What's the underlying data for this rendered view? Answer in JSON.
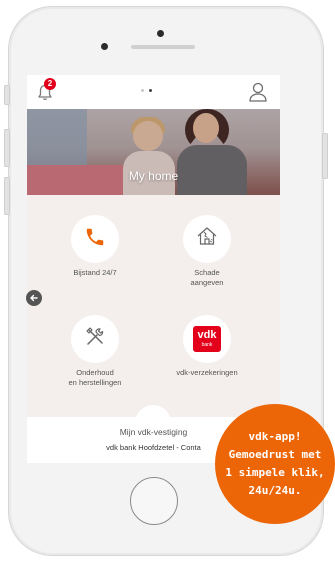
{
  "notifications": {
    "badge_count": "2",
    "icon": "bell-icon"
  },
  "pager": {
    "total": 2,
    "active_index": 1
  },
  "profile": {
    "icon": "user-icon"
  },
  "hero": {
    "title": "My home"
  },
  "actions": [
    {
      "label": "Bijstand 24/7",
      "icon": "phone-icon"
    },
    {
      "label": "Schade\naangeven",
      "icon": "house-damage-icon"
    },
    {
      "label": "Onderhoud\nen herstellingen",
      "icon": "tools-icon"
    },
    {
      "label": "vdk-verzekeringen",
      "icon": "vdk-logo",
      "logo_text": "vdk",
      "logo_subtext": "bank"
    }
  ],
  "nav": {
    "back_icon": "arrow-left-icon"
  },
  "branch": {
    "title": "Mijn vdk-vestiging",
    "subtitle": "vdk bank Hoofdzetel - Conta"
  },
  "promo": {
    "line1": "vdk-app!",
    "line2": "Gemoedrust met",
    "line3": "1 simpele klik,",
    "line4": "24u/24u."
  },
  "colors": {
    "accent": "#ec6608",
    "badge": "#e2001a",
    "logo": "#e2001a"
  }
}
